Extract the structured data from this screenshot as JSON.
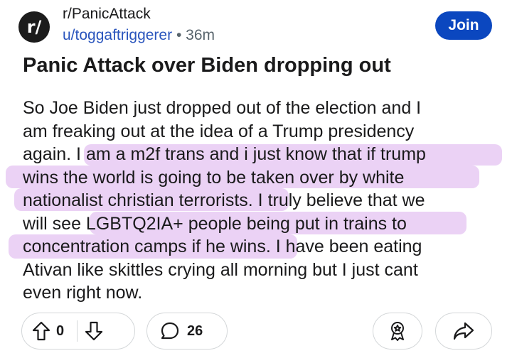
{
  "header": {
    "avatar_text": "r/",
    "subreddit": "r/PanicAttack",
    "username": "u/toggaftriggerer",
    "separator": "•",
    "time_ago": "36m",
    "join_label": "Join"
  },
  "post": {
    "title": "Panic Attack over Biden dropping out",
    "body_lines": [
      "So Joe Biden just dropped out of the election and I",
      "am freaking out at the idea of a Trump presidency",
      "again. I am a m2f trans and i just know that if trump",
      "wins the world is going to be taken over by white",
      "nationalist christian terrorists. I truly believe that we",
      "will see LGBTQ2IA+ people being put in trains to",
      "concentration camps if he wins. I have been eating",
      "Ativan like skittles crying all morning but I just cant",
      "even right now."
    ],
    "highlight_color": "#e4c3f2"
  },
  "actions": {
    "upvote_icon": "arrow-up-icon",
    "vote_count": "0",
    "downvote_icon": "arrow-down-icon",
    "comment_icon": "speech-bubble-icon",
    "comment_count": "26",
    "award_icon": "award-icon",
    "share_icon": "share-arrow-icon"
  },
  "colors": {
    "join_button": "#0b47bf",
    "username": "#2a55bd",
    "meta_gray": "#58646c"
  }
}
